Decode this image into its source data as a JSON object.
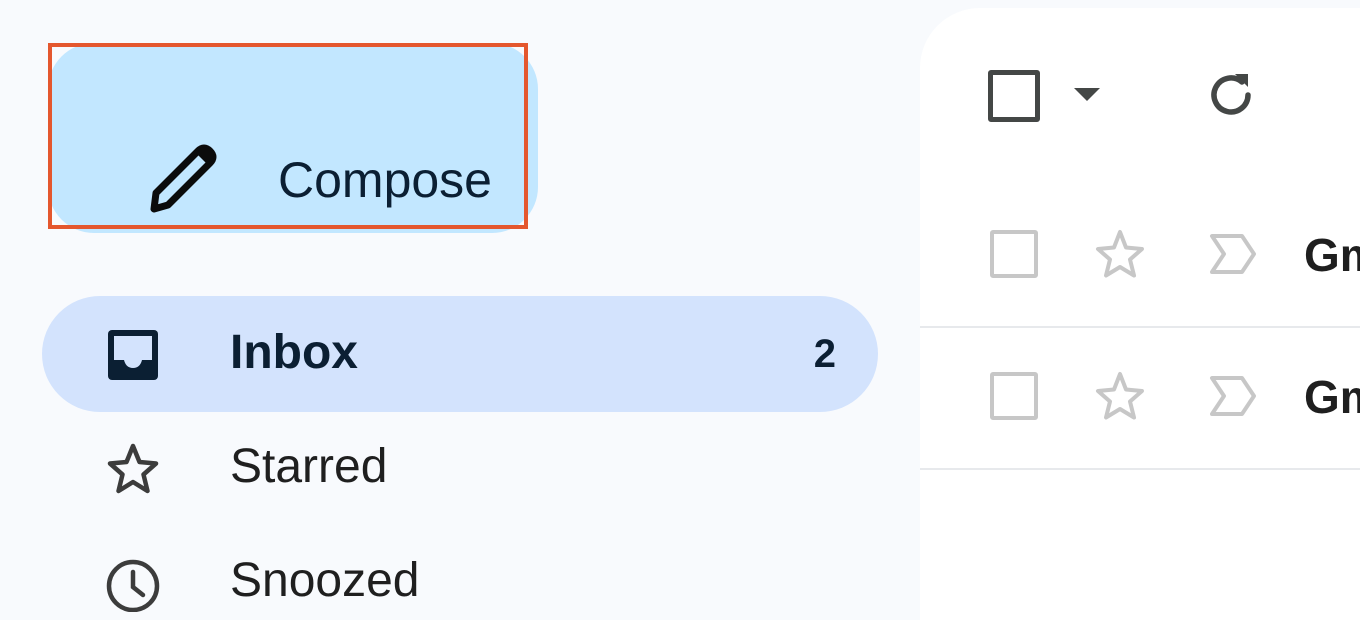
{
  "sidebar": {
    "compose": {
      "label": "Compose"
    },
    "items": [
      {
        "label": "Inbox",
        "count": "2",
        "icon": "inbox-icon",
        "active": true
      },
      {
        "label": "Starred",
        "count": "",
        "icon": "star-icon",
        "active": false
      },
      {
        "label": "Snoozed",
        "count": "",
        "icon": "clock-icon",
        "active": false
      }
    ]
  },
  "toolbar": {
    "select_icon": "checkbox-icon",
    "select_menu_icon": "caret-down-icon",
    "refresh_icon": "refresh-icon"
  },
  "mail_list": [
    {
      "sender": "Gm"
    },
    {
      "sender": "Gm"
    }
  ],
  "colors": {
    "compose_bg": "#c2e7ff",
    "highlight": "#e4572e",
    "active_nav_bg": "#d3e3fd",
    "sidebar_bg": "#f8fafd",
    "main_bg": "#ffffff"
  }
}
